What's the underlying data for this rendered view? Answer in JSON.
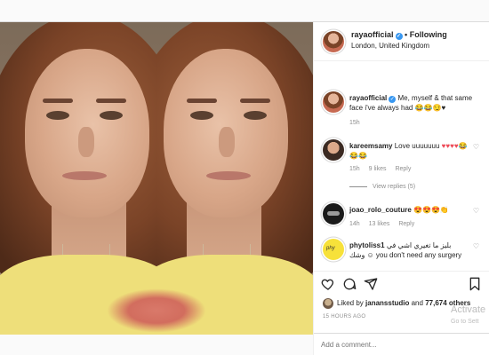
{
  "post": {
    "username": "rayaofficial",
    "follow_label": "Following",
    "location": "London, United Kingdom",
    "caption": "Me, myself & that same face i've always had",
    "caption_emojis": "😂😂😏♥",
    "caption_time": "15h"
  },
  "comments": [
    {
      "username": "kareemsamy",
      "text": "Love uuuuuuu",
      "emojis": "♥♥♥♥😂😂😂",
      "time": "15h",
      "likes": "9 likes",
      "reply": "Reply",
      "view_replies": "View replies (5)"
    },
    {
      "username": "joao_rolo_couture",
      "emojis": "😍😍😍👏",
      "time": "14h",
      "likes": "13 likes",
      "reply": "Reply"
    },
    {
      "username": "phytoliss1",
      "text": "بليز ما تغيري اشي في وشك ☺ you don't need any surgery"
    }
  ],
  "actions": {
    "liked_by_prefix": "Liked by",
    "liked_by_user": "janansstudio",
    "liked_by_and": "and",
    "liked_by_count": "77,674 others",
    "time_ago": "15 HOURS AGO"
  },
  "add_comment_placeholder": "Add a comment...",
  "watermark": {
    "line1": "Activate",
    "line2": "Go to Sett"
  },
  "colors": {
    "link_blue": "#3897f0",
    "heart_red": "#ed4956",
    "muted": "#8e8e8e"
  }
}
